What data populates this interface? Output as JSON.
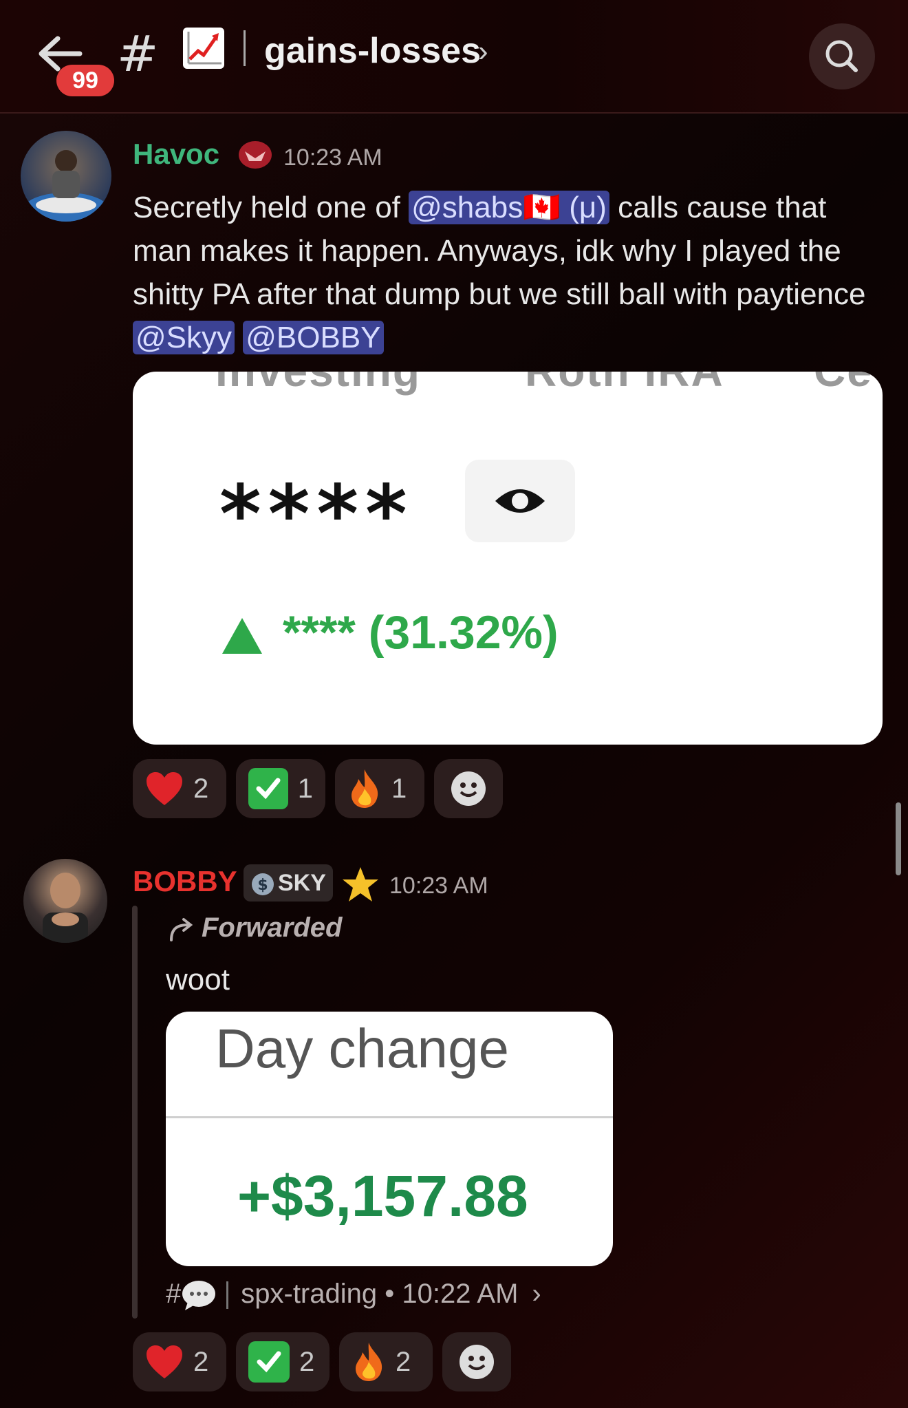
{
  "header": {
    "unread_count": "99",
    "hash": "#",
    "channel_name": "gains-losses",
    "chevron": "›",
    "chart_emoji": "chart-increasing",
    "accent": "#e23b3b"
  },
  "messages": [
    {
      "author": "Havoc",
      "author_color": "#3fb67c",
      "time": "10:23 AM",
      "text_parts": {
        "p1": "Secretly held one of ",
        "mention1": "@shabs🇨🇦 (μ)",
        "p2": " calls cause that man makes it happen. Anyways, idk why I played the shitty PA after that dump but we still ball with paytience ",
        "mention2": "@Skyy",
        "mention3": "@BOBBY"
      },
      "card": {
        "top_left_text": "Investing",
        "top_mid_text": "Roth IRA",
        "top_right_text": "Ce",
        "masked_value": "****",
        "gain_text": "**** (31.32%)"
      },
      "reactions": [
        {
          "emoji": "heart",
          "count": "2"
        },
        {
          "emoji": "check",
          "count": "1"
        },
        {
          "emoji": "fire",
          "count": "1"
        }
      ]
    },
    {
      "author": "BOBBY",
      "author_color": "#e8322e",
      "role_tag": "SKY",
      "time": "10:23 AM",
      "forwarded_label": "Forwarded",
      "text": "woot",
      "card": {
        "title": "Day change",
        "amount": "+$3,157.88"
      },
      "source": {
        "channel": "spx-trading",
        "time": "10:22 AM",
        "separator": "•"
      },
      "reactions": [
        {
          "emoji": "heart",
          "count": "2"
        },
        {
          "emoji": "check",
          "count": "2"
        },
        {
          "emoji": "fire",
          "count": "2"
        }
      ]
    }
  ]
}
